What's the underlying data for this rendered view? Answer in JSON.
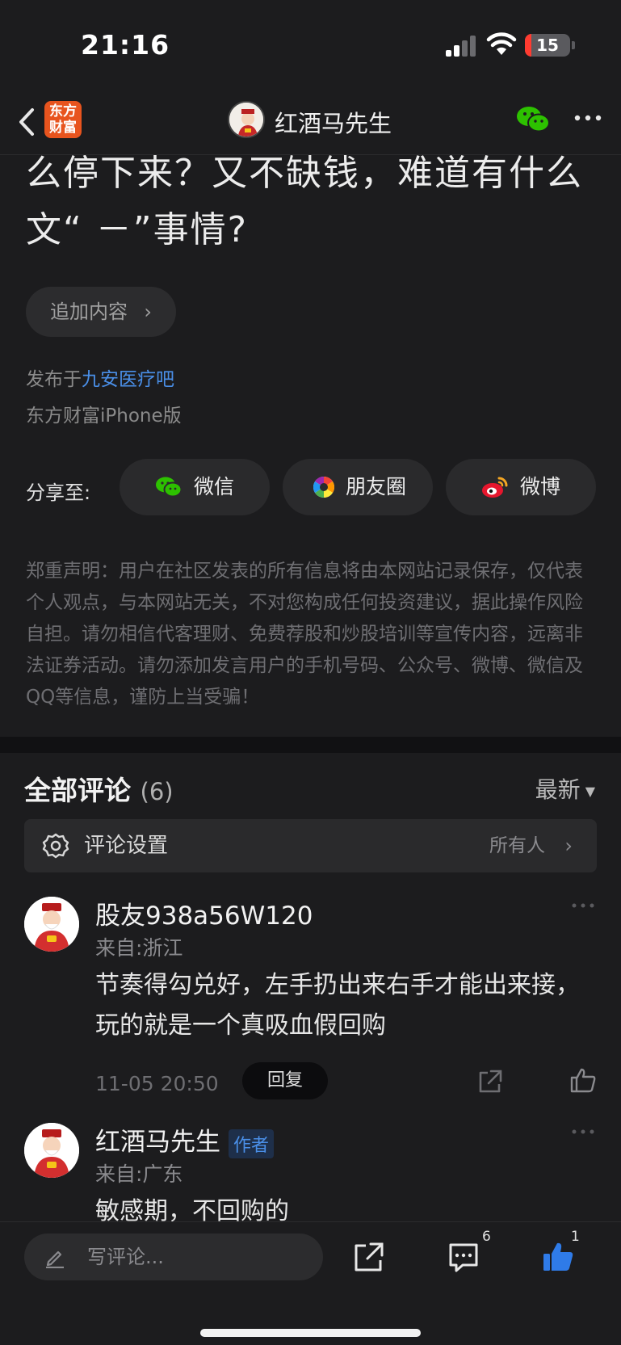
{
  "status_bar": {
    "time": "21:16",
    "battery": "15",
    "battery_level": 0.15
  },
  "nav": {
    "app_logo_line1": "东方",
    "app_logo_line2": "财富",
    "title": "红酒马先生"
  },
  "post": {
    "title_line1": "么停下来？又不缺钱，难道有什么",
    "title_line2": "文“ －”事情?",
    "add_content": "追加内容",
    "published_prefix": "发布于",
    "board": "九安医疗吧",
    "platform": "东方财富iPhone版"
  },
  "share": {
    "label": "分享至:",
    "wechat": "微信",
    "moments": "朋友圈",
    "weibo": "微博"
  },
  "disclaimer": "郑重声明：用户在社区发表的所有信息将由本网站记录保存，仅代表个人观点，与本网站无关，不对您构成任何投资建议，据此操作风险自担。请勿相信代客理财、免费荐股和炒股培训等宣传内容，远离非法证券活动。请勿添加发言用户的手机号码、公众号、微博、微信及QQ等信息，谨防上当受骗！",
  "comments": {
    "title": "全部评论",
    "count": "(6)",
    "sort": "最新",
    "settings_label": "评论设置",
    "settings_value": "所有人",
    "items": [
      {
        "name": "股友938a56W120",
        "location": "来自:浙江",
        "text": "节奏得勾兑好，左手扔出来右手才能出来接，玩的就是一个真吸血假回购",
        "time": "11-05 20:50",
        "reply": "回复"
      },
      {
        "name": "红酒马先生",
        "badge": "作者",
        "location": "来自:广东",
        "text": "敏感期，不回购的"
      }
    ]
  },
  "bottom": {
    "placeholder": "写评论...",
    "comment_count": "6",
    "like_count": "1"
  },
  "colors": {
    "accent_blue": "#4a8fe8",
    "logo_orange": "#e8541e",
    "wechat_green": "#2dc100",
    "battery_red": "#ff3b30"
  }
}
